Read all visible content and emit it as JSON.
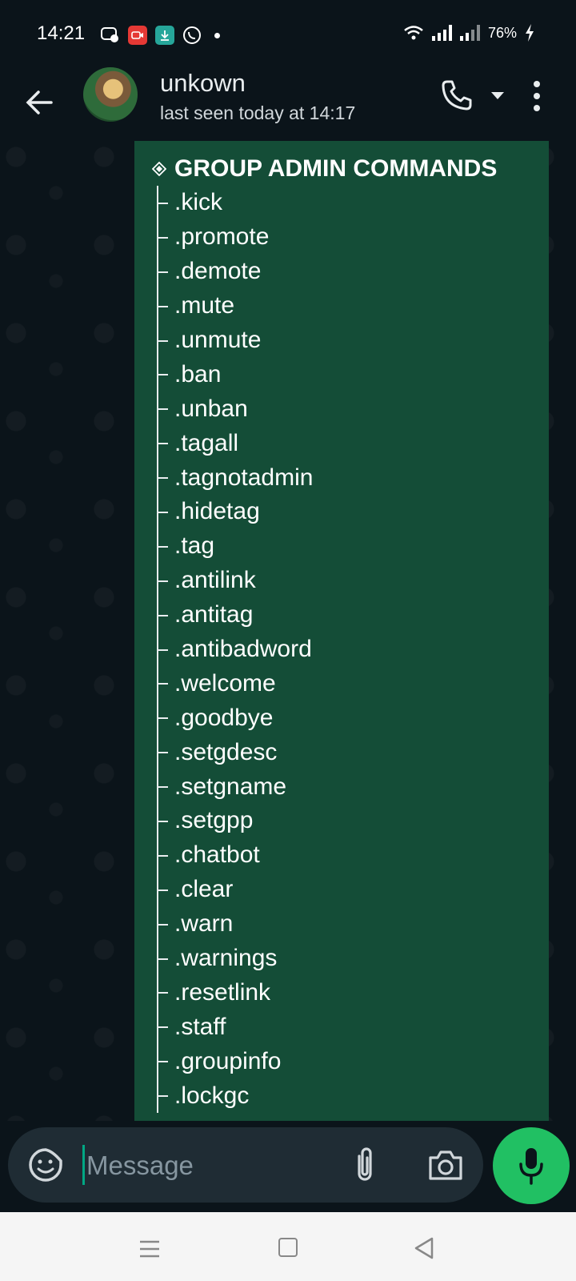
{
  "status_bar": {
    "time": "14:21",
    "battery": "76%",
    "colors": {
      "video_icon": "#e53935",
      "download_icon": "#26a69a"
    }
  },
  "header": {
    "contact_name": "unkown",
    "last_seen": "last seen today at 14:17"
  },
  "message": {
    "title": "GROUP ADMIN COMMANDS",
    "commands": [
      ".kick",
      ".promote",
      ".demote",
      ".mute",
      ".unmute",
      ".ban",
      ".unban",
      ".tagall",
      ".tagnotadmin",
      ".hidetag",
      ".tag",
      ".antilink",
      ".antitag",
      ".antibadword",
      ".welcome",
      ".goodbye",
      ".setgdesc",
      ".setgname",
      ".setgpp",
      ".chatbot",
      ".clear",
      ".warn",
      ".warnings",
      ".resetlink",
      ".staff",
      ".groupinfo",
      ".lockgc"
    ]
  },
  "composer": {
    "placeholder": "Message"
  },
  "colors": {
    "bubble": "#144d37",
    "accent": "#21c063",
    "background": "#0b141a"
  }
}
